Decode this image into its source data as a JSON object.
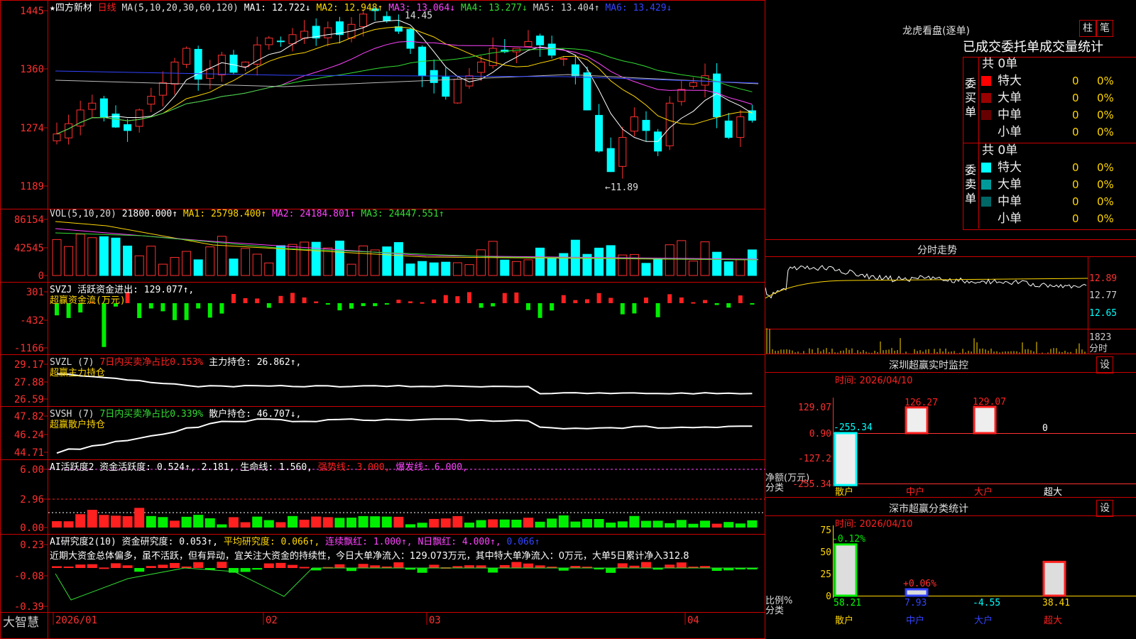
{
  "stock": {
    "name": "★四方新材",
    "period": "日线",
    "ma_header": "MA(5,10,20,30,60,120)",
    "ma": [
      {
        "label": "MA1: 12.722↓",
        "color": "#ffffff"
      },
      {
        "label": "MA2: 12.948↑",
        "color": "#ffd700"
      },
      {
        "label": "MA3: 13.064↓",
        "color": "#ff44ff"
      },
      {
        "label": "MA4: 13.277↓",
        "color": "#33dd33"
      },
      {
        "label": "MA5: 13.404↑",
        "color": "#cfcfcf"
      },
      {
        "label": "MA6: 13.429↓",
        "color": "#3344ff"
      }
    ],
    "high_mark": "14.45",
    "low_mark": "←11.89"
  },
  "price_axis": [
    "1445",
    "1360",
    "1274",
    "1189"
  ],
  "vol": {
    "header": "VOL(5,10,20)",
    "value": "21800.000↑",
    "ma1": "MA1: 25798.400↑",
    "ma2": "MA2: 24184.801↑",
    "ma3": "MA3: 24447.551↑",
    "axis": [
      "86154",
      "42545",
      "0"
    ]
  },
  "svzj": {
    "header": "SVZJ  活跃资金进出: 129.077↑,",
    "sub": "超赢资金流(万元)",
    "axis": [
      "301",
      "-432",
      "-1166"
    ]
  },
  "svzl": {
    "header": "SVZL (7) ",
    "pct": "7日内买卖净占比0.153%",
    "hold": " 主力持仓: 26.862↑,",
    "sub": "超赢主力持仓",
    "axis": [
      "29.17",
      "27.88",
      "26.59"
    ]
  },
  "svsh": {
    "header": "SVSH (7) ",
    "pct": "7日内买卖净占比0.339%",
    "hold": " 散户持仓: 46.707↓,",
    "sub": "超赢散户持仓",
    "axis": [
      "47.82",
      "46.24",
      "44.71"
    ]
  },
  "ai1": {
    "header": "AI活跃度2 资金活跃度: 0.524↑, 2.181, 生命线: 1.560, ",
    "strong": "强势线: 3.000, ",
    "burst": "爆发线: 6.000,",
    "axis": [
      "6.00",
      "2.96",
      "0.00"
    ]
  },
  "ai2": {
    "header": "AI研究度2(10) 资金研究度: 0.053↑, ",
    "avg": "平均研究度: 0.066↑, ",
    "red": "连续飘红: 1.000↑, ",
    "nred": "N日飘红: 4.000↑, ",
    "last": "0.066↑",
    "comment": "近期大资金总体偏多，虽不活跃，但有异动，宜关注大资金的持续性，今日大单净流入：129.073万元，其中特大单净流入：0万元，大单5日累计净入312.8",
    "axis": [
      "0.23",
      "-0.08",
      "-0.39"
    ]
  },
  "date_axis": [
    "2026/01",
    "02",
    "03",
    "04"
  ],
  "brand": "大智慧",
  "dragon": {
    "title": "龙虎看盘(逐单)",
    "btn1": "柱",
    "btn2": "笔",
    "subtitle": "已成交委托单成交量统计",
    "buy_label": "委买单",
    "sell_label": "委卖单",
    "buy_total": "共 0单",
    "sell_total": "共 0单",
    "rows_buy": [
      {
        "name": "特大",
        "n": "0",
        "p": "0%",
        "color": "#ff0000"
      },
      {
        "name": "大单",
        "n": "0",
        "p": "0%",
        "color": "#990000"
      },
      {
        "name": "中单",
        "n": "0",
        "p": "0%",
        "color": "#660000"
      },
      {
        "name": "小单",
        "n": "0",
        "p": "0%",
        "color": "#000000"
      }
    ],
    "rows_sell": [
      {
        "name": "特大",
        "n": "0",
        "p": "0%",
        "color": "#00ffff"
      },
      {
        "name": "大单",
        "n": "0",
        "p": "0%",
        "color": "#009999"
      },
      {
        "name": "中单",
        "n": "0",
        "p": "0%",
        "color": "#006666"
      },
      {
        "name": "小单",
        "n": "0",
        "p": "0%",
        "color": "#000000"
      }
    ]
  },
  "intraday": {
    "title": "分时走势",
    "prices": [
      "12.89",
      "12.77",
      "12.65"
    ],
    "vol_max": "1823",
    "vol_label": "分时"
  },
  "sz_monitor": {
    "title": "深圳超赢实时监控",
    "set": "设",
    "time": "时间: 2026/04/10",
    "axis": [
      "129.07",
      "0.90",
      "-127.2",
      "-255.34"
    ],
    "footer1": "净额(万元)",
    "footer2": "分类",
    "bars": [
      {
        "cat": "散户",
        "val": "-255.34",
        "cat_color": "#ffd700",
        "val_color": "#00ffff"
      },
      {
        "cat": "中户",
        "val": "126.27",
        "cat_color": "#ff2020",
        "val_color": "#ff2020"
      },
      {
        "cat": "大户",
        "val": "129.07",
        "cat_color": "#ff2020",
        "val_color": "#ff2020"
      },
      {
        "cat": "超大",
        "val": "0",
        "cat_color": "#ffffff",
        "val_color": "#ffffff"
      }
    ]
  },
  "sz_stats": {
    "title": "深市超赢分类统计",
    "set": "设",
    "time": "时间: 2026/04/10",
    "axis": [
      "75",
      "50",
      "25",
      "0"
    ],
    "footer1": "比例%",
    "footer2": "分类",
    "bars": [
      {
        "cat": "散户",
        "val": "58.21",
        "chg": "-0.12%",
        "cat_color": "#ffd700",
        "val_color": "#00ff00"
      },
      {
        "cat": "中户",
        "val": "7.93",
        "chg": "+0.06%",
        "cat_color": "#3344ff",
        "val_color": "#3344ff"
      },
      {
        "cat": "大户",
        "val": "-4.55",
        "chg": "",
        "cat_color": "#3344ff",
        "val_color": "#00ffff"
      },
      {
        "cat": "超大",
        "val": "38.41",
        "chg": "",
        "cat_color": "#ff2020",
        "val_color": "#ffd700"
      }
    ]
  }
}
